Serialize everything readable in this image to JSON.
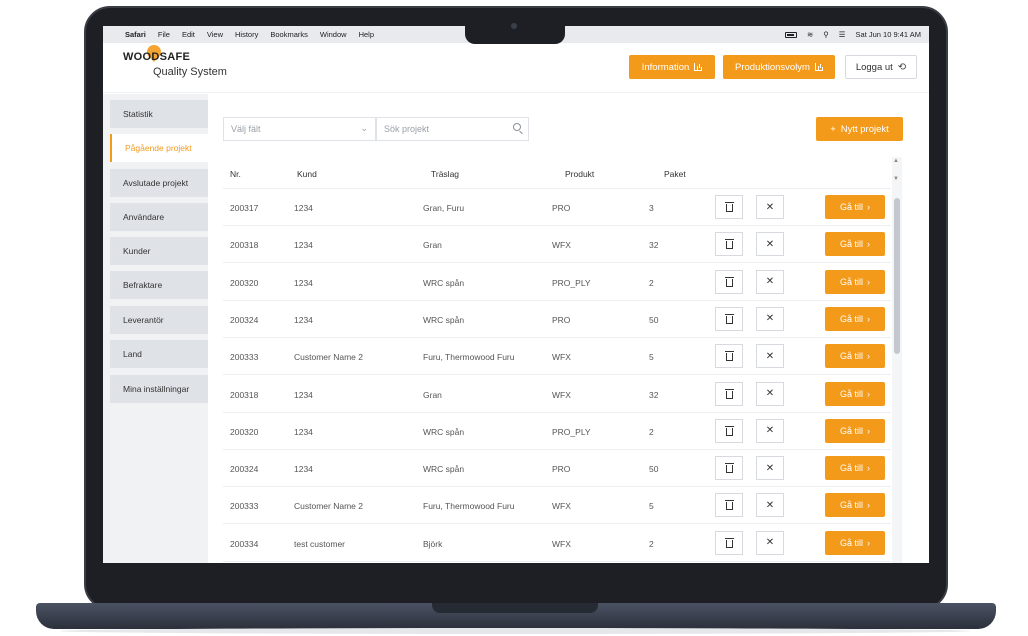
{
  "menubar": {
    "app": "Safari",
    "items": [
      "File",
      "Edit",
      "View",
      "History",
      "Bookmarks",
      "Window",
      "Help"
    ],
    "datetime": "Sat Jun 10  9:41 AM"
  },
  "header": {
    "brand": "WOODSAFE",
    "subtitle": "Quality System",
    "info_label": "Information",
    "prod_label": "Produktionsvolym",
    "logout_label": "Logga ut"
  },
  "sidebar": {
    "items": [
      {
        "label": "Statistik"
      },
      {
        "label": "Pågående projekt"
      },
      {
        "label": "Avslutade projekt"
      },
      {
        "label": "Användare"
      },
      {
        "label": "Kunder"
      },
      {
        "label": "Befraktare"
      },
      {
        "label": "Leverantör"
      },
      {
        "label": "Land"
      },
      {
        "label": "Mina inställningar"
      }
    ],
    "active_index": 1
  },
  "filters": {
    "field_placeholder": "Välj fält",
    "search_placeholder": "Sök projekt",
    "new_label": "Nytt projekt"
  },
  "table": {
    "headers": [
      "Nr.",
      "Kund",
      "Träslag",
      "Produkt",
      "Paket"
    ],
    "go_label": "Gå till",
    "rows": [
      {
        "nr": "200317",
        "kund": "1234",
        "traslag": "Gran, Furu",
        "produkt": "PRO",
        "paket": "3"
      },
      {
        "nr": "200318",
        "kund": "1234",
        "traslag": "Gran",
        "produkt": "WFX",
        "paket": "32"
      },
      {
        "nr": "200320",
        "kund": "1234",
        "traslag": "WRC spån",
        "produkt": "PRO_PLY",
        "paket": "2"
      },
      {
        "nr": "200324",
        "kund": "1234",
        "traslag": "WRC spån",
        "produkt": "PRO",
        "paket": "50"
      },
      {
        "nr": "200333",
        "kund": "Customer Name 2",
        "traslag": "Furu, Thermowood Furu",
        "produkt": "WFX",
        "paket": "5"
      },
      {
        "nr": "200318",
        "kund": "1234",
        "traslag": "Gran",
        "produkt": "WFX",
        "paket": "32"
      },
      {
        "nr": "200320",
        "kund": "1234",
        "traslag": "WRC spån",
        "produkt": "PRO_PLY",
        "paket": "2"
      },
      {
        "nr": "200324",
        "kund": "1234",
        "traslag": "WRC spån",
        "produkt": "PRO",
        "paket": "50"
      },
      {
        "nr": "200333",
        "kund": "Customer Name 2",
        "traslag": "Furu, Thermowood Furu",
        "produkt": "WFX",
        "paket": "5"
      },
      {
        "nr": "200334",
        "kund": "test customer",
        "traslag": "Björk",
        "produkt": "WFX",
        "paket": "2"
      }
    ]
  },
  "colors": {
    "accent": "#f49a1b",
    "sidebar_bg": "#dfe2e7"
  }
}
